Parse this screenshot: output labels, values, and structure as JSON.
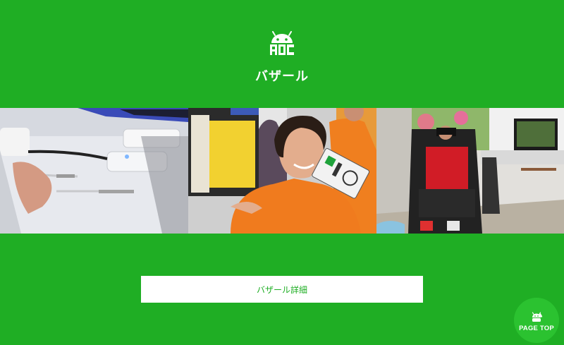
{
  "header": {
    "logo_icon": "android-robot-aoc-logo-icon",
    "title": "バザール"
  },
  "gallery": {
    "photos": [
      {
        "icon": "tech-devices-photo"
      },
      {
        "icon": "exhibitor-staff-photo"
      },
      {
        "icon": "vr-racing-simulator-photo"
      }
    ]
  },
  "details_button": {
    "label": "バザール詳細"
  },
  "page_top": {
    "label": "PAGE TOP",
    "icon": "android-robot-pointing-icon"
  },
  "colors": {
    "background": "#1fae24",
    "accent": "#2bc230",
    "button_bg": "#ffffff"
  }
}
